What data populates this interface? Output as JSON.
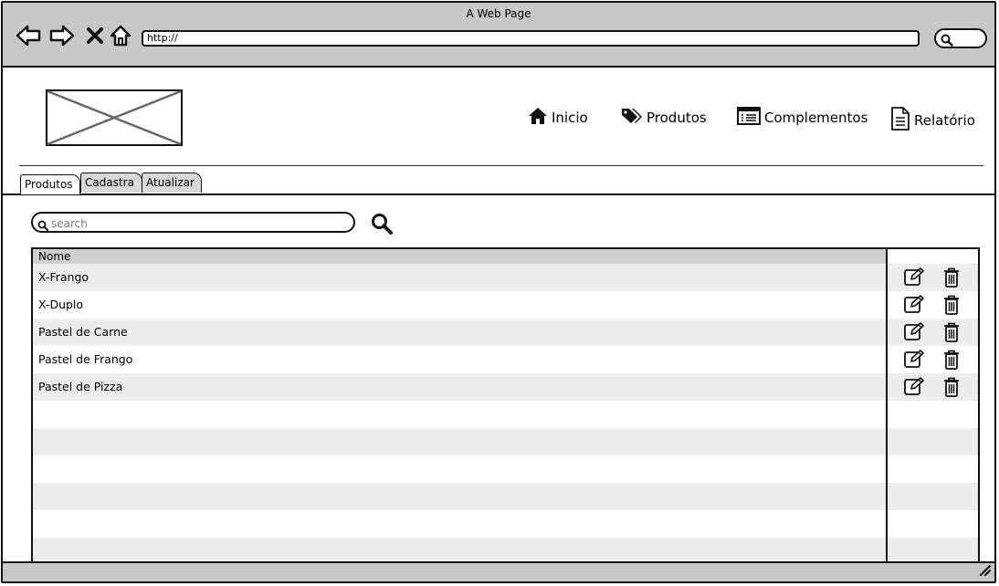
{
  "window": {
    "title": "A Web Page"
  },
  "browser": {
    "url": "http://",
    "icons": [
      "back-arrow-icon",
      "forward-arrow-icon",
      "close-x-icon",
      "home-icon",
      "search-icon"
    ]
  },
  "nav": {
    "items": [
      {
        "label": "Inicio",
        "icon": "home-icon"
      },
      {
        "label": "Produtos",
        "icon": "tags-icon"
      },
      {
        "label": "Complementos",
        "icon": "list-icon"
      },
      {
        "label": "Relatório",
        "icon": "document-icon"
      }
    ]
  },
  "tabs": [
    {
      "label": "Produtos",
      "active": true
    },
    {
      "label": "Cadastra",
      "active": false
    },
    {
      "label": "Atualizar",
      "active": false
    }
  ],
  "search": {
    "placeholder": "search"
  },
  "table": {
    "columns": [
      "Nome"
    ],
    "rows": [
      {
        "name": "X-Frango"
      },
      {
        "name": "X-Duplo"
      },
      {
        "name": "Pastel de Carne"
      },
      {
        "name": "Pastel de Frango"
      },
      {
        "name": "Pastel de Pizza"
      }
    ],
    "row_action_icons": [
      "edit-icon",
      "trash-icon"
    ]
  },
  "colors": {
    "chrome": "#c8c8c8",
    "row_alt": "#ececec",
    "header": "#cfcfcf",
    "stroke": "#111111"
  }
}
